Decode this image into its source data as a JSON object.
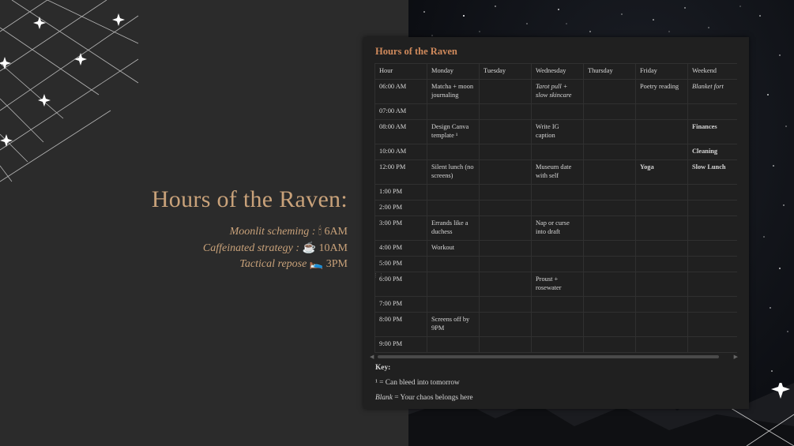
{
  "hero": {
    "title": "Hours of the Raven:",
    "lines": [
      {
        "label": "Moonlit scheming :",
        "emoji": "🕯",
        "time": "6AM"
      },
      {
        "label": "Caffeinated strategy :",
        "emoji": "☕",
        "time": "10AM"
      },
      {
        "label": "Tactical repose",
        "emoji": "🛌",
        "time": "3PM"
      }
    ]
  },
  "panel": {
    "title": "Hours of the Raven",
    "columns": [
      "Hour",
      "Monday",
      "Tuesday",
      "Wednesday",
      "Thursday",
      "Friday",
      "Weekend"
    ],
    "rows": [
      {
        "hour": "06:00 AM",
        "monday": "Matcha + moon journaling",
        "tuesday": "",
        "wednesday": "Tarot pull + slow skincare",
        "thursday": "",
        "friday": "Poetry reading",
        "weekend": "Blanket fort"
      },
      {
        "hour": "07:00 AM",
        "monday": "",
        "tuesday": "",
        "wednesday": "",
        "thursday": "",
        "friday": "",
        "weekend": ""
      },
      {
        "hour": "08:00 AM",
        "monday": "Design Canva template ¹",
        "tuesday": "",
        "wednesday": "Write IG caption",
        "thursday": "",
        "friday": "",
        "weekend": "Finances"
      },
      {
        "hour": "10:00 AM",
        "monday": "",
        "tuesday": "",
        "wednesday": "",
        "thursday": "",
        "friday": "",
        "weekend": "Cleaning"
      },
      {
        "hour": "12:00 PM",
        "monday": "Silent lunch (no screens)",
        "tuesday": "",
        "wednesday": "Museum date with self",
        "thursday": "",
        "friday": "Yoga",
        "weekend": "Slow Lunch"
      },
      {
        "hour": "1:00 PM",
        "monday": "",
        "tuesday": "",
        "wednesday": "",
        "thursday": "",
        "friday": "",
        "weekend": ""
      },
      {
        "hour": "2:00 PM",
        "monday": "",
        "tuesday": "",
        "wednesday": "",
        "thursday": "",
        "friday": "",
        "weekend": ""
      },
      {
        "hour": "3:00 PM",
        "monday": "Errands like a duchess",
        "tuesday": "",
        "wednesday": "Nap or curse into draft",
        "thursday": "",
        "friday": "",
        "weekend": ""
      },
      {
        "hour": "4:00 PM",
        "monday": "Workout",
        "tuesday": "",
        "wednesday": "",
        "thursday": "",
        "friday": "",
        "weekend": ""
      },
      {
        "hour": "5:00 PM",
        "monday": "",
        "tuesday": "",
        "wednesday": "",
        "thursday": "",
        "friday": "",
        "weekend": ""
      },
      {
        "hour": "6:00 PM",
        "monday": "",
        "tuesday": "",
        "wednesday": "Proust + rosewater",
        "thursday": "",
        "friday": "",
        "weekend": ""
      },
      {
        "hour": "7:00 PM",
        "monday": "",
        "tuesday": "",
        "wednesday": "",
        "thursday": "",
        "friday": "",
        "weekend": ""
      },
      {
        "hour": "8:00 PM",
        "monday": "Screens off by 9PM",
        "tuesday": "",
        "wednesday": "",
        "thursday": "",
        "friday": "",
        "weekend": ""
      },
      {
        "hour": "9:00 PM",
        "monday": "",
        "tuesday": "",
        "wednesday": "",
        "thursday": "",
        "friday": "",
        "weekend": ""
      }
    ],
    "key": {
      "title": "Key:",
      "line1": "¹ = Can bleed into tomorrow",
      "line2_em": "Blank",
      "line2_rest": " = Your chaos belongs here"
    }
  },
  "colors": {
    "accent": "#d08a5c",
    "hero": "#c9a27a",
    "panel_bg": "#202020"
  }
}
